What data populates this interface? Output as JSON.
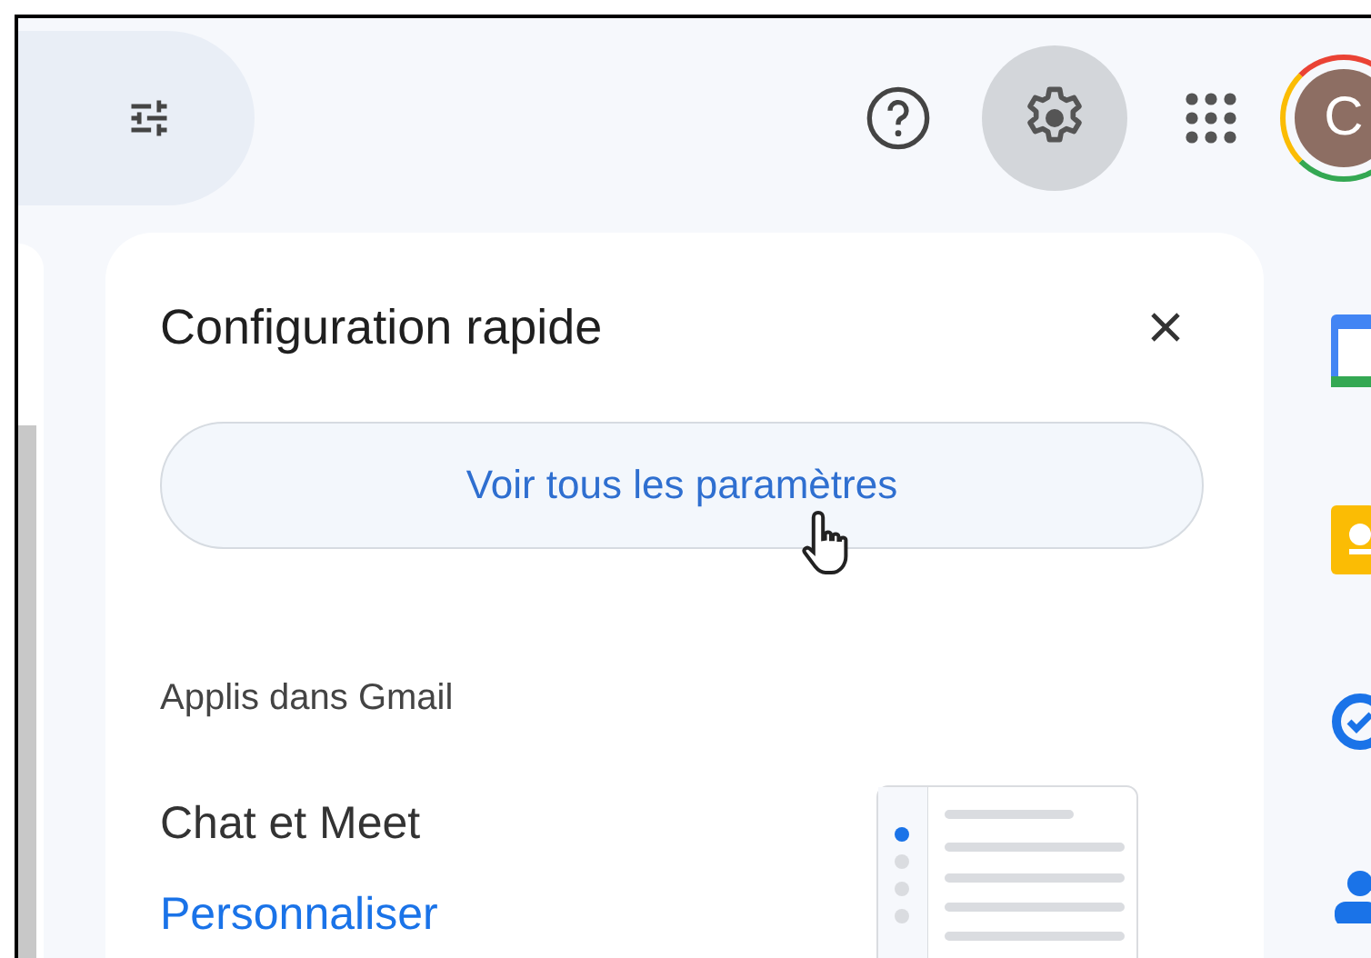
{
  "toolbar": {
    "settings_button": {
      "selected": true
    },
    "avatar": {
      "initial": "C"
    }
  },
  "quick_settings": {
    "title": "Configuration rapide",
    "all_settings_button": "Voir tous les paramètres",
    "section_label": "Applis dans Gmail",
    "apps_option": {
      "label": "Chat et Meet",
      "link": "Personnaliser"
    }
  }
}
